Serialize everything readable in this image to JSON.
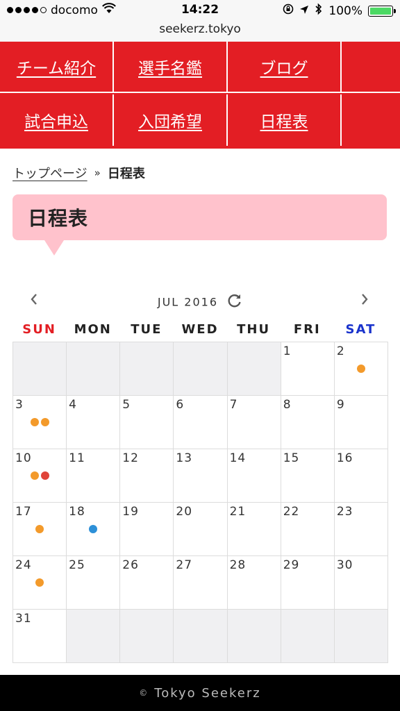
{
  "statusbar": {
    "carrier": "docomo",
    "time": "14:22",
    "battery": "100%",
    "url": "seekerz.tokyo"
  },
  "nav": {
    "items": [
      {
        "label": "チーム紹介"
      },
      {
        "label": "選手名鑑"
      },
      {
        "label": "ブログ"
      },
      {
        "label": "試合申込"
      },
      {
        "label": "入団希望"
      },
      {
        "label": "日程表"
      }
    ]
  },
  "breadcrumb": {
    "home": "トップページ",
    "separator": "»",
    "current": "日程表"
  },
  "page": {
    "title": "日程表"
  },
  "calendar": {
    "month_label": "JUL 2016",
    "prev_icon": "‹",
    "next_icon": "›",
    "weekdays": [
      "SUN",
      "MON",
      "TUE",
      "WED",
      "THU",
      "FRI",
      "SAT"
    ],
    "leading_blanks": 5,
    "days": 31,
    "event_colors": {
      "orange": "#f39a2b",
      "red": "#e0443a",
      "blue": "#2d90d8"
    },
    "events": {
      "2": [
        "orange"
      ],
      "3": [
        "orange",
        "orange"
      ],
      "10": [
        "orange",
        "red"
      ],
      "17": [
        "orange"
      ],
      "18": [
        "blue"
      ],
      "24": [
        "orange"
      ]
    }
  },
  "footer": {
    "copyright_symbol": "©",
    "text": "Tokyo Seekerz"
  },
  "colors": {
    "nav_red": "#e31e24",
    "title_pink": "#ffc2cc",
    "sunday": "#e31e24",
    "saturday": "#1a33cc"
  }
}
